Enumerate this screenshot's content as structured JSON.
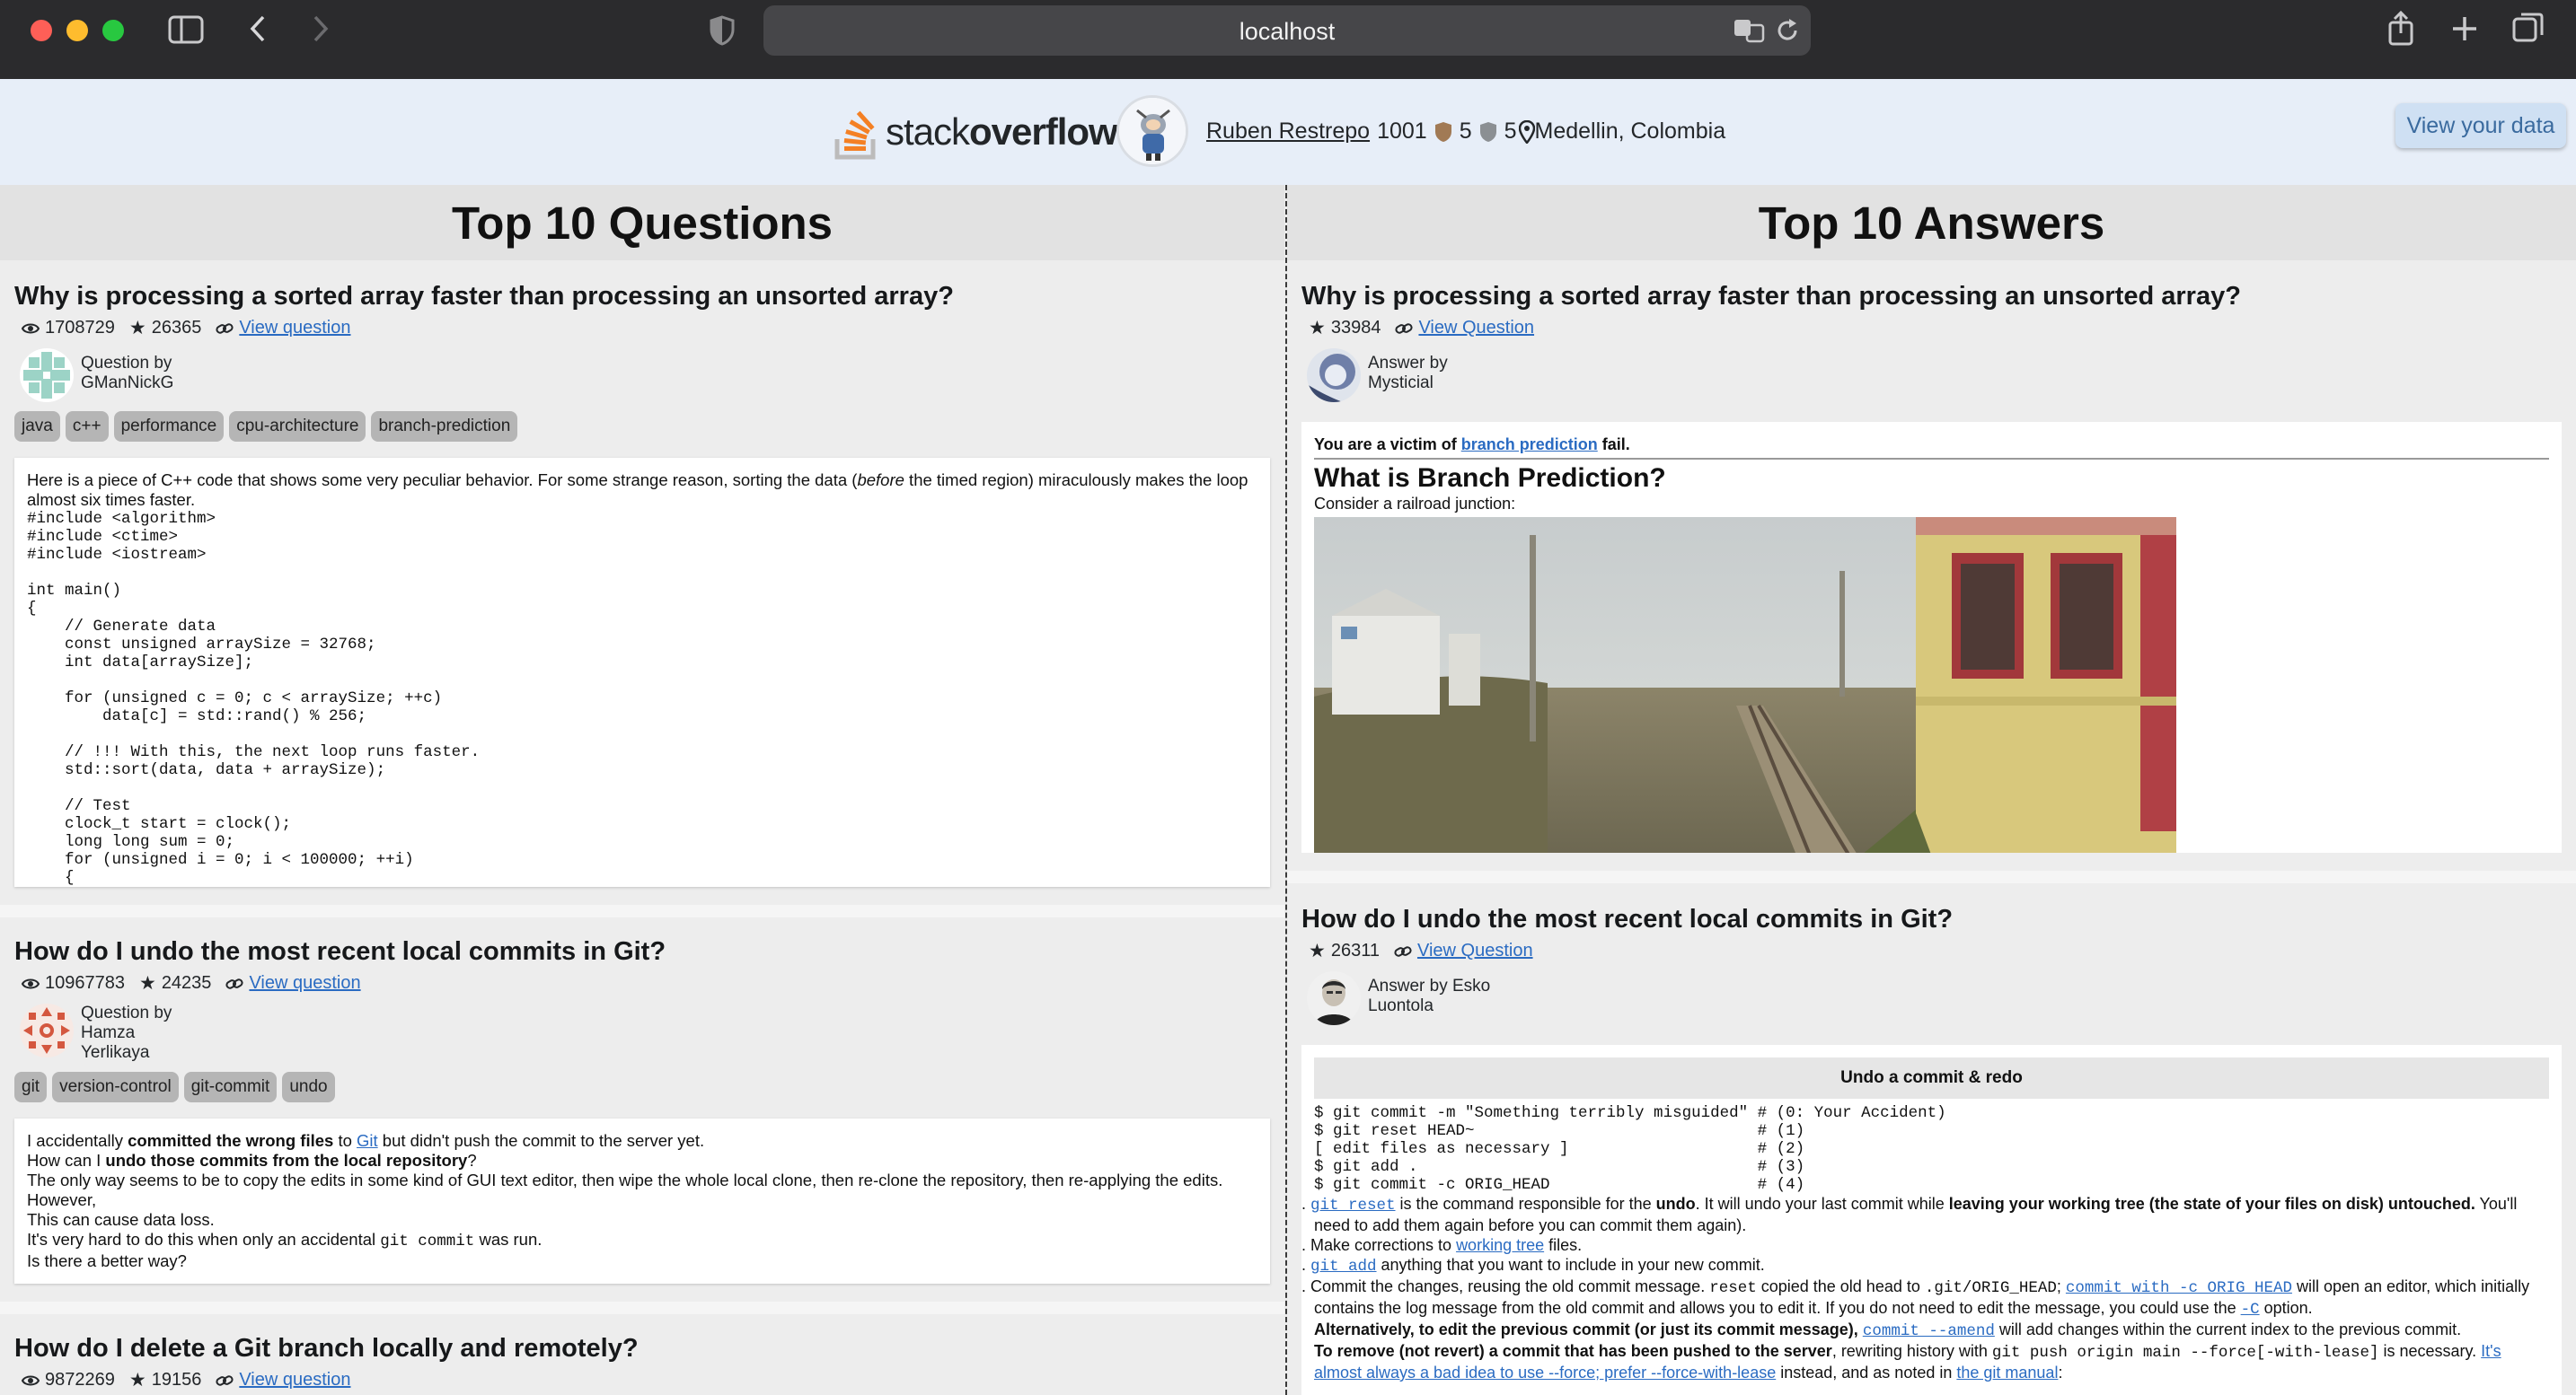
{
  "browser": {
    "url": "localhost"
  },
  "header": {
    "logo_light": "stack",
    "logo_bold": "overflow",
    "user_name": "Ruben Restrepo",
    "reputation": "1001",
    "silver_badges": "5",
    "bronze_badges": "5",
    "location": "Medellin, Colombia",
    "view_data_label": "View your data"
  },
  "questions": {
    "heading": "Top 10 Questions",
    "items": [
      {
        "title": "Why is processing a sorted array faster than processing an unsorted array?",
        "views": "1708729",
        "score": "26365",
        "link": "View question",
        "author_prefix": "Question by",
        "author": "GManNickG",
        "tags": [
          "java",
          "c++",
          "performance",
          "cpu-architecture",
          "branch-prediction"
        ],
        "intro_1": "Here is a piece of C++ code that shows some very peculiar behavior. For some strange reason, sorting the data (",
        "intro_em": "before",
        "intro_2": " the timed region) miraculously makes the loop almost six times faster.",
        "code": "#include <algorithm>\n#include <ctime>\n#include <iostream>\n\nint main()\n{\n    // Generate data\n    const unsigned arraySize = 32768;\n    int data[arraySize];\n\n    for (unsigned c = 0; c < arraySize; ++c)\n        data[c] = std::rand() % 256;\n\n    // !!! With this, the next loop runs faster.\n    std::sort(data, data + arraySize);\n\n    // Test\n    clock_t start = clock();\n    long long sum = 0;\n    for (unsigned i = 0; i < 100000; ++i)\n    {"
      },
      {
        "title": "How do I undo the most recent local commits in Git?",
        "views": "10967783",
        "score": "24235",
        "link": "View question",
        "author_prefix": "Question by",
        "author_l1": "Hamza",
        "author_l2": "Yerlikaya",
        "tags": [
          "git",
          "version-control",
          "git-commit",
          "undo"
        ],
        "p1_a": "I accidentally ",
        "p1_b": "committed the wrong files",
        "p1_c": " to ",
        "p1_link": "Git",
        "p1_d": " but didn't push the commit to the server yet.",
        "p2_a": "How can I ",
        "p2_b": "undo those commits from the local repository",
        "p2_c": "?",
        "p3": "The only way seems to be to copy the edits in some kind of GUI text editor, then wipe the whole local clone, then re-clone the repository, then re-applying the edits. However,",
        "p4": "This can cause data loss.",
        "p5_a": "It's very hard to do this when only an accidental ",
        "p5_code": "git commit",
        "p5_b": " was run.",
        "p6": "Is there a better way?"
      },
      {
        "title": "How do I delete a Git branch locally and remotely?",
        "views": "9872269",
        "score": "19156",
        "link": "View question"
      }
    ]
  },
  "answers": {
    "heading": "Top 10 Answers",
    "items": [
      {
        "title": "Why is processing a sorted array faster than processing an unsorted array?",
        "score": "33984",
        "link": "View Question",
        "author_prefix": "Answer by",
        "author": "Mysticial",
        "victim_a": "You are a victim of ",
        "victim_link": "branch prediction",
        "victim_b": " fail.",
        "subheading": "What is Branch Prediction?",
        "caption": "Consider a railroad junction:"
      },
      {
        "title": "How do I undo the most recent local commits in Git?",
        "score": "26311",
        "link": "View Question",
        "author_prefix": "Answer by Esko",
        "author_l2": "Luontola",
        "table_heading": "Undo a commit & redo",
        "code": "$ git commit -m \"Something terribly misguided\" # (0: Your Accident)\n$ git reset HEAD~                              # (1)\n[ edit files as necessary ]                    # (2)\n$ git add .                                    # (3)\n$ git commit -c ORIG_HEAD                      # (4)",
        "l1_link": "git reset",
        "l1_a": " is the command responsible for the ",
        "l1_b": "undo",
        "l1_c": ". It will undo your last commit while ",
        "l1_d": "leaving your working tree (the state of your files on disk) untouched.",
        "l1_e": " You'll need to add them again before you can commit them again).",
        "l2_a": "Make corrections to ",
        "l2_link": "working tree",
        "l2_b": " files.",
        "l3_link": "git add",
        "l3_a": " anything that you want to include in your new commit.",
        "l4_a": "Commit the changes, reusing the old commit message. ",
        "l4_code1": "reset",
        "l4_b": " copied the old head to ",
        "l4_code2": ".git/ORIG_HEAD",
        "l4_c": "; ",
        "l4_link": "commit with -c ORIG_HEAD",
        "l4_d": " will open an editor, which initially contains the log message from the old commit and allows you to edit it. If you do not need to edit the message, you could use the ",
        "l4_link2": "-C",
        "l4_e": " option.",
        "l5_a": "Alternatively, to edit the previous commit (or just its commit message), ",
        "l5_link": "commit --amend",
        "l5_b": " will add changes within the current index to the previous commit.",
        "l6_a": "To remove (not revert) a commit that has been pushed to the server",
        "l6_b": ", rewriting history with ",
        "l6_code": "git push origin main --force[-with-lease]",
        "l6_c": " is necessary. ",
        "l6_link": "It's almost always a bad idea to use --force; prefer --force-with-lease",
        "l6_d": " instead, and as noted in ",
        "l6_link2": "the git manual",
        "l6_e": ":"
      }
    ]
  }
}
